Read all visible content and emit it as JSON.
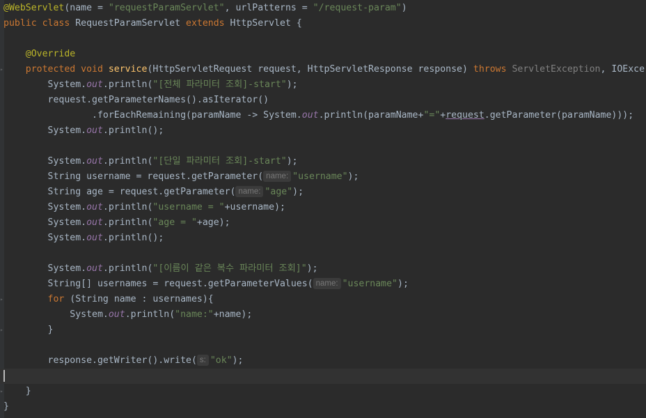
{
  "editor": {
    "lines": [
      {
        "tokens": [
          {
            "t": "@WebServlet",
            "c": "ann"
          },
          {
            "t": "(name = "
          },
          {
            "t": "\"requestParamServlet\"",
            "c": "str"
          },
          {
            "t": ", urlPatterns = "
          },
          {
            "t": "\"/request-param\"",
            "c": "str"
          },
          {
            "t": ")"
          }
        ]
      },
      {
        "tokens": [
          {
            "t": "public class ",
            "c": "kw"
          },
          {
            "t": "RequestParamServlet "
          },
          {
            "t": "extends ",
            "c": "kw"
          },
          {
            "t": "HttpServlet {"
          }
        ]
      },
      {
        "tokens": []
      },
      {
        "tokens": [
          {
            "t": "    "
          },
          {
            "t": "@Override",
            "c": "ann"
          }
        ]
      },
      {
        "fold": true,
        "tokens": [
          {
            "t": "    "
          },
          {
            "t": "protected void ",
            "c": "kw"
          },
          {
            "t": "service",
            "c": "fn"
          },
          {
            "t": "(HttpServletRequest request, HttpServletResponse response) "
          },
          {
            "t": "throws ",
            "c": "kw"
          },
          {
            "t": "ServletException",
            "c": "type-ex"
          },
          {
            "t": ", IOExce"
          }
        ]
      },
      {
        "tokens": [
          {
            "t": "        System."
          },
          {
            "t": "out",
            "c": "field"
          },
          {
            "t": ".println("
          },
          {
            "t": "\"[전체 파라미터 조회]-start\"",
            "c": "str"
          },
          {
            "t": ");"
          }
        ]
      },
      {
        "tokens": [
          {
            "t": "        request.getParameterNames().asIterator()"
          }
        ]
      },
      {
        "tokens": [
          {
            "t": "                .forEachRemaining(paramName -> System."
          },
          {
            "t": "out",
            "c": "field"
          },
          {
            "t": ".println(paramName+"
          },
          {
            "t": "\"=\"",
            "c": "str"
          },
          {
            "t": "+"
          },
          {
            "t": "request",
            "c": "under"
          },
          {
            "t": ".getParameter(paramName)));"
          }
        ]
      },
      {
        "tokens": [
          {
            "t": "        System."
          },
          {
            "t": "out",
            "c": "field"
          },
          {
            "t": ".println();"
          }
        ]
      },
      {
        "tokens": []
      },
      {
        "tokens": [
          {
            "t": "        System."
          },
          {
            "t": "out",
            "c": "field"
          },
          {
            "t": ".println("
          },
          {
            "t": "\"[단일 파라미터 조회]-start\"",
            "c": "str"
          },
          {
            "t": ");"
          }
        ]
      },
      {
        "tokens": [
          {
            "t": "        String username = request.getParameter("
          },
          {
            "t": "name:",
            "c": "hint"
          },
          {
            "t": "\"username\"",
            "c": "str"
          },
          {
            "t": ");"
          }
        ]
      },
      {
        "tokens": [
          {
            "t": "        String age = request.getParameter("
          },
          {
            "t": "name:",
            "c": "hint"
          },
          {
            "t": "\"age\"",
            "c": "str"
          },
          {
            "t": ");"
          }
        ]
      },
      {
        "tokens": [
          {
            "t": "        System."
          },
          {
            "t": "out",
            "c": "field"
          },
          {
            "t": ".println("
          },
          {
            "t": "\"username = \"",
            "c": "str"
          },
          {
            "t": "+username);"
          }
        ]
      },
      {
        "tokens": [
          {
            "t": "        System."
          },
          {
            "t": "out",
            "c": "field"
          },
          {
            "t": ".println("
          },
          {
            "t": "\"age = \"",
            "c": "str"
          },
          {
            "t": "+age);"
          }
        ]
      },
      {
        "tokens": [
          {
            "t": "        System."
          },
          {
            "t": "out",
            "c": "field"
          },
          {
            "t": ".println();"
          }
        ]
      },
      {
        "tokens": []
      },
      {
        "tokens": [
          {
            "t": "        System."
          },
          {
            "t": "out",
            "c": "field"
          },
          {
            "t": ".println("
          },
          {
            "t": "\"[이름이 같은 복수 파라미터 조회]\"",
            "c": "str"
          },
          {
            "t": ");"
          }
        ]
      },
      {
        "tokens": [
          {
            "t": "        String[] usernames = request.getParameterValues("
          },
          {
            "t": "name:",
            "c": "hint"
          },
          {
            "t": "\"username\"",
            "c": "str"
          },
          {
            "t": ");"
          }
        ]
      },
      {
        "fold": true,
        "tokens": [
          {
            "t": "        "
          },
          {
            "t": "for ",
            "c": "kw"
          },
          {
            "t": "(String name : usernames){"
          }
        ]
      },
      {
        "tokens": [
          {
            "t": "            System."
          },
          {
            "t": "out",
            "c": "field"
          },
          {
            "t": ".println("
          },
          {
            "t": "\"name:\"",
            "c": "str"
          },
          {
            "t": "+name);"
          }
        ]
      },
      {
        "fold": true,
        "tokens": [
          {
            "t": "        }"
          }
        ]
      },
      {
        "tokens": []
      },
      {
        "tokens": [
          {
            "t": "        response.getWriter().write("
          },
          {
            "t": "s:",
            "c": "hint"
          },
          {
            "t": "\"ok\"",
            "c": "str"
          },
          {
            "t": ");"
          }
        ]
      },
      {
        "current": true,
        "tokens": []
      },
      {
        "fold": true,
        "tokens": [
          {
            "t": "    }"
          }
        ]
      },
      {
        "tokens": [
          {
            "t": "}"
          }
        ]
      }
    ]
  }
}
